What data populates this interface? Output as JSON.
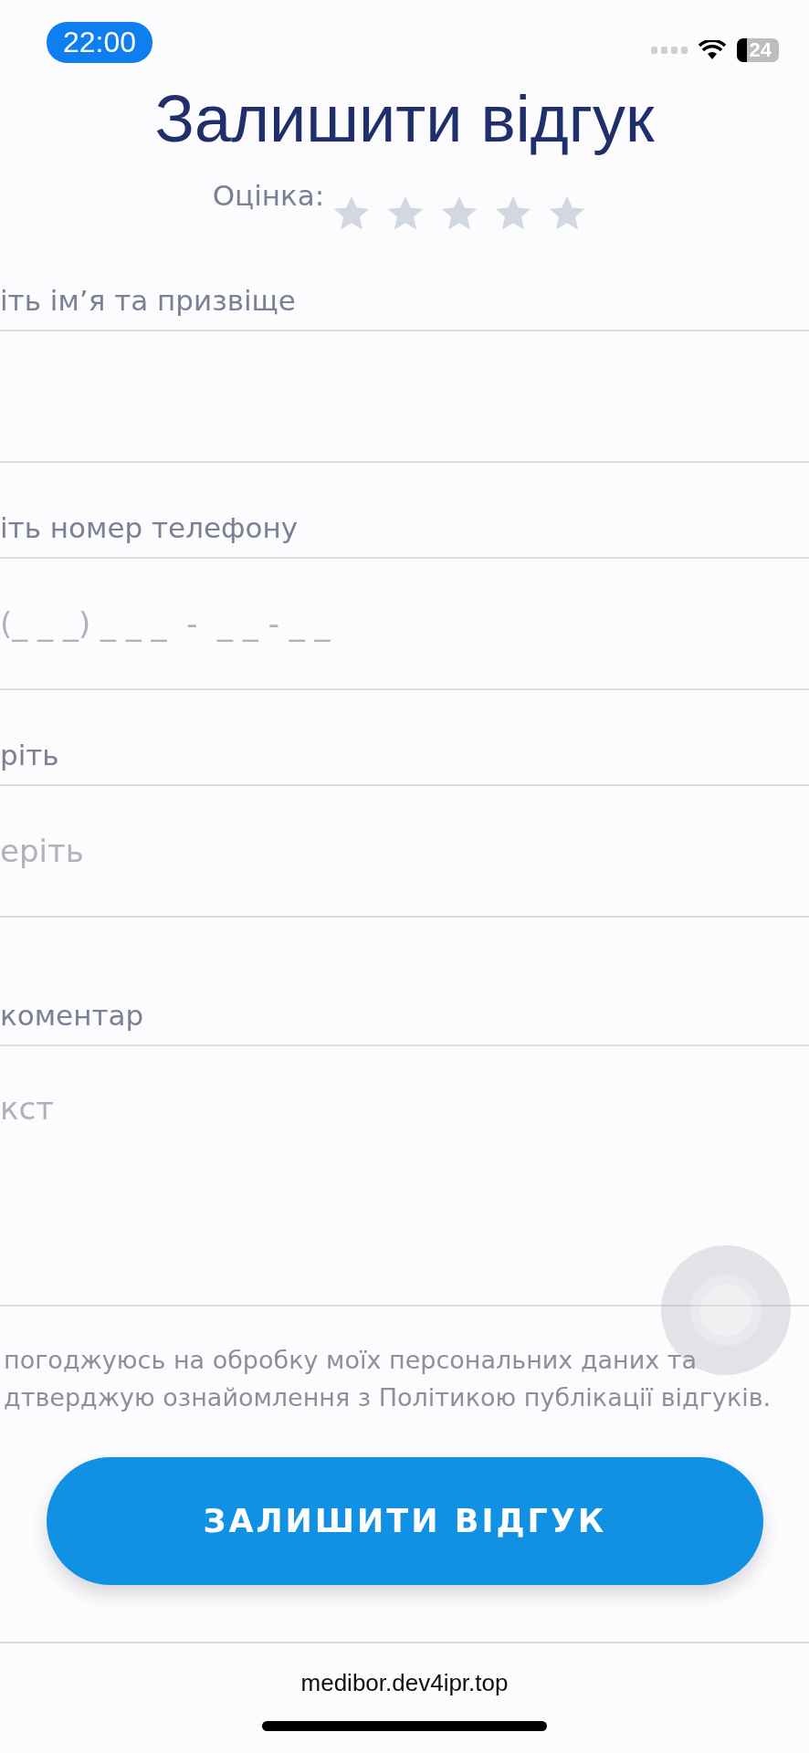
{
  "status_bar": {
    "time": "22:00",
    "battery": "24"
  },
  "title": "Залишити відгук",
  "rating": {
    "label": "Оцінка:",
    "stars": 0
  },
  "fields": [
    {
      "kind": "input",
      "label": "іть ім’я та призвіще"
    },
    {
      "kind": "input",
      "label": "іть номер телефону",
      "placeholder": "(_ _ _) _ _ _  -  _ _ - _ _"
    },
    {
      "kind": "input",
      "label": "ріть",
      "placeholder": "еріть"
    },
    {
      "kind": "textarea",
      "label": "коментар",
      "placeholder": "кст"
    }
  ],
  "consent": "погоджуюсь на обробку моїх персональних даних та\nдтверджую ознайомлення з Політикою публікації відгуків.",
  "submit_button": "ЗАЛИШИТИ ВІДГУК",
  "url": "medibor.dev4ipr.top"
}
